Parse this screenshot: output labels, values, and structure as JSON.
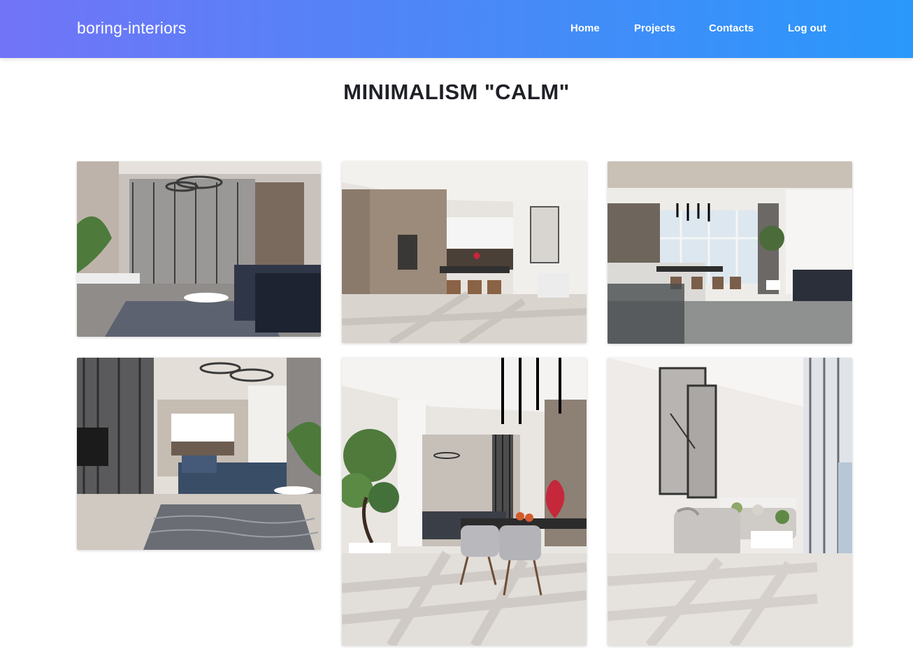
{
  "navbar": {
    "brand": "boring-interiors",
    "links": [
      {
        "label": "Home"
      },
      {
        "label": "Projects"
      },
      {
        "label": "Contacts"
      },
      {
        "label": "Log out"
      }
    ]
  },
  "page": {
    "title": "MINIMALISM \"CALM\""
  },
  "gallery": {
    "photos": [
      {
        "scene": "living-room-with-rings-chandelier"
      },
      {
        "scene": "kitchen-with-wood-cabinets"
      },
      {
        "scene": "dining-area-with-windows"
      },
      {
        "scene": "living-room-with-blue-sofa"
      },
      {
        "scene": "dining-with-plant-and-chairs"
      },
      {
        "scene": "lounge-with-artwork-and-windows"
      }
    ]
  },
  "colors": {
    "nav_gradient_start": "#7274f7",
    "nav_gradient_end": "#2a98fb",
    "title_text": "#1f2126"
  }
}
